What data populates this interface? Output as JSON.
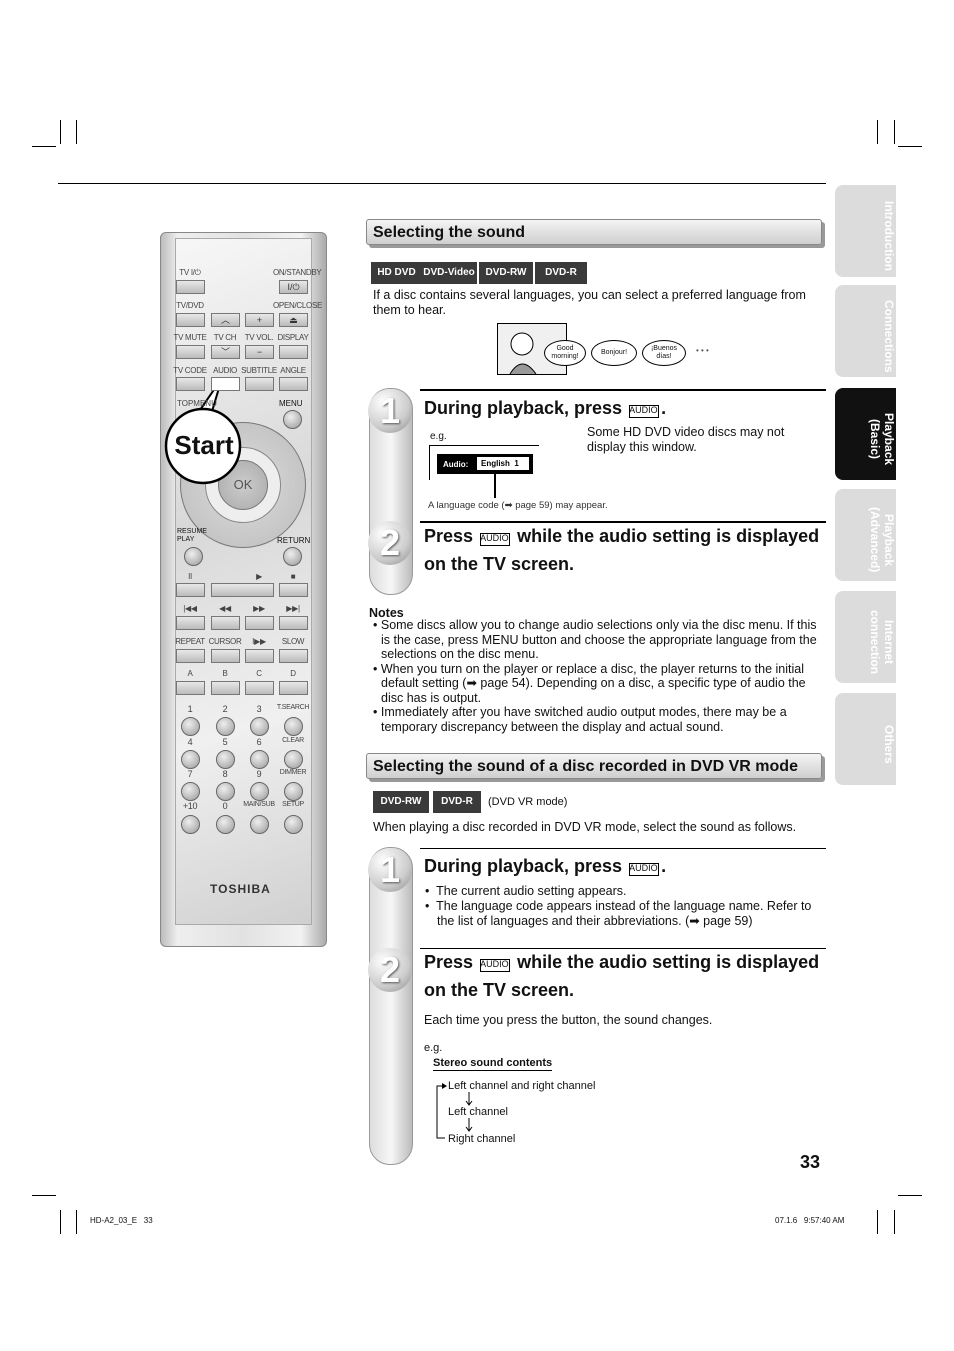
{
  "sections": {
    "s1": {
      "title": "Selecting the sound",
      "badges": [
        "HD DVD",
        "DVD-Video",
        "DVD-RW",
        "DVD-R"
      ],
      "intro": "If a disc contains several languages, you can select a preferred language from them to hear.",
      "bubbles": [
        "Good morning!",
        "Bonjour!",
        "¡Buenos días!"
      ],
      "ellipsis": "• • •",
      "step1": {
        "num": "1",
        "title": "During playback, press",
        "key": "AUDIO",
        "eg": "e.g.",
        "osd_label": "Audio:",
        "osd_value": "English  1",
        "note_right": "Some HD DVD video discs may not display this window.",
        "caption": "A language code (➡ page 59) may appear."
      },
      "step2": {
        "num": "2",
        "pre": "Press",
        "key": "AUDIO",
        "post": "while the audio setting is displayed on the TV screen."
      },
      "notes_title": "Notes",
      "notes": [
        "Some discs allow you to change audio selections only via the disc menu. If this is the case, press MENU button and choose the appropriate language from the selections on the disc menu.",
        "When you turn on the player or replace a disc, the player returns to the initial default setting (➡ page 54). Depending on a disc, a specific type of audio the disc has is output.",
        "Immediately after you have switched audio output modes, there may be a temporary discrepancy between the display and actual sound."
      ]
    },
    "s2": {
      "title": "Selecting the sound of a disc recorded in DVD VR mode",
      "badges": [
        "DVD-RW",
        "DVD-R"
      ],
      "mode": "(DVD VR mode)",
      "intro": "When playing a disc recorded in DVD VR mode, select the sound as follows.",
      "step1": {
        "num": "1",
        "title": "During playback, press",
        "key": "AUDIO",
        "bullets": [
          "The current audio setting appears.",
          "The language code appears instead of the language name. Refer to the list of languages and their abbreviations. (➡ page 59)"
        ]
      },
      "step2": {
        "num": "2",
        "pre": "Press",
        "key": "AUDIO",
        "post": "while the audio setting is displayed on the TV screen.",
        "desc": "Each time you press the button, the sound changes.",
        "eg": "e.g.",
        "list_title": "Stereo sound contents",
        "list": [
          "Left channel and right channel",
          "Left channel",
          "Right channel"
        ]
      }
    }
  },
  "side_tabs": [
    {
      "label": "Introduction",
      "active": false
    },
    {
      "label": "Connections",
      "active": false
    },
    {
      "label": "Playback (Basic)",
      "active": true
    },
    {
      "label": "Playback (Advanced)",
      "active": false
    },
    {
      "label": "Internet connection",
      "active": false
    },
    {
      "label": "Others",
      "active": false
    }
  ],
  "page_number": "33",
  "footer": {
    "left": "HD-A2_03_E   33",
    "right": "07.1.6   9:57:40 AM"
  },
  "remote": {
    "start_label": "Start",
    "brand": "TOSHIBA",
    "ok": "OK",
    "rows": [
      {
        "labels": [
          "TV I/⏻",
          "",
          "",
          "ON/STANDBY"
        ],
        "keys": [
          "",
          "-",
          "-",
          "I/⏻"
        ]
      },
      {
        "labels": [
          "TV/DVD",
          "",
          "",
          "OPEN/CLOSE"
        ],
        "keys": [
          "",
          "︿",
          "+",
          "⏏"
        ]
      },
      {
        "labels": [
          "TV MUTE",
          "TV CH",
          "TV VOL.",
          "DISPLAY"
        ],
        "keys": [
          "",
          "﹀",
          "−",
          ""
        ]
      },
      {
        "labels": [
          "TV CODE",
          "AUDIO",
          "SUBTITLE",
          "ANGLE"
        ],
        "keys": [
          "",
          "",
          "",
          ""
        ]
      },
      {
        "labels": [
          "II",
          "",
          "▶",
          "■"
        ],
        "keys": [
          "",
          "",
          "-",
          ""
        ]
      },
      {
        "labels": [
          "|◀◀",
          "◀◀",
          "▶▶",
          "▶▶|"
        ],
        "keys": [
          "",
          "",
          "",
          ""
        ]
      },
      {
        "labels": [
          "REPEAT",
          "CURSOR",
          "I▶▶",
          "SLOW"
        ],
        "keys": [
          "",
          "",
          "",
          ""
        ]
      },
      {
        "labels": [
          "A",
          "B",
          "C",
          "D"
        ],
        "keys": [
          "",
          "",
          "",
          ""
        ]
      }
    ],
    "circle_rows": [
      [
        "1",
        "2",
        "3",
        "T.SEARCH"
      ],
      [
        "4",
        "5",
        "6",
        "CLEAR"
      ],
      [
        "7",
        "8",
        "9",
        "DIMMER"
      ],
      [
        "+10",
        "0",
        "MAIN/SUB",
        "SETUP"
      ]
    ],
    "topmenu": "TOPMENU",
    "menu": "MENU",
    "resume": "RESUME PLAY",
    "return": "RETURN"
  },
  "accent": {
    "badge": "#3a3a3a",
    "active_tab": "#111111",
    "tab": "#dcdcdc"
  }
}
